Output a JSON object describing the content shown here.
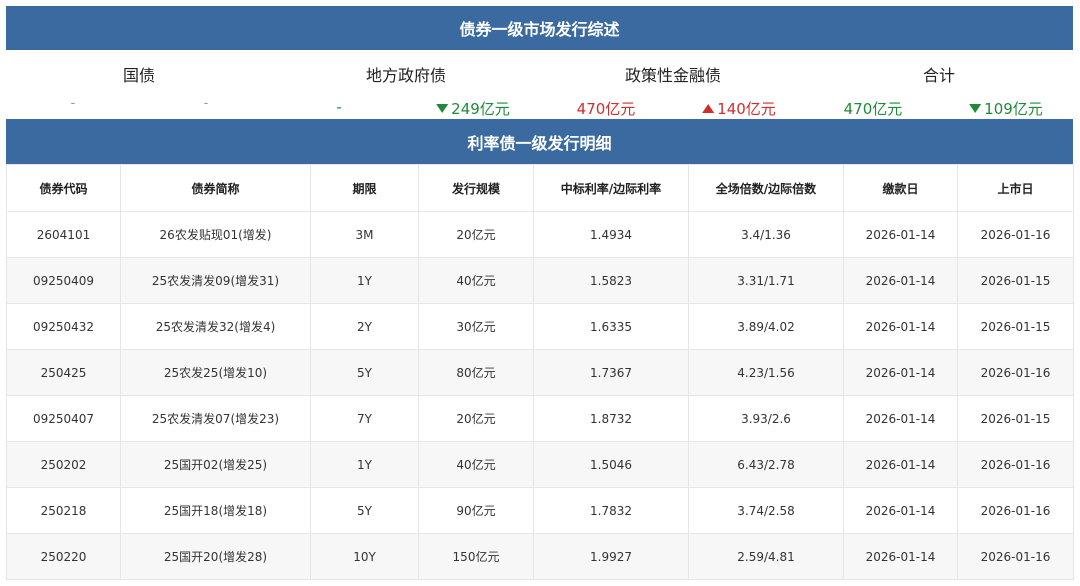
{
  "header": {
    "title": "债券一级市场发行综述"
  },
  "summary": {
    "categories": [
      "国债",
      "地方政府债",
      "政策性金融债",
      "合计"
    ],
    "values": [
      {
        "text": "-",
        "color": "#999999"
      },
      {
        "text": "-",
        "color": "#999999"
      },
      {
        "text": "-",
        "color": "#1f8a3a"
      },
      {
        "text": "249亿元",
        "color": "#1f8a3a",
        "arrow": "down"
      },
      {
        "text": "470亿元",
        "color": "#d12d2d"
      },
      {
        "text": "140亿元",
        "color": "#d12d2d",
        "arrow": "up"
      },
      {
        "text": "470亿元",
        "color": "#1f8a3a"
      },
      {
        "text": "109亿元",
        "color": "#1f8a3a",
        "arrow": "down"
      }
    ]
  },
  "detail": {
    "title": "利率债一级发行明细",
    "columns": [
      "债券代码",
      "债券简称",
      "期限",
      "发行规模",
      "中标利率/边际利率",
      "全场倍数/边际倍数",
      "缴款日",
      "上市日"
    ],
    "rows": [
      [
        "2604101",
        "26农发贴现01(增发)",
        "3M",
        "20亿元",
        "1.4934",
        "3.4/1.36",
        "2026-01-14",
        "2026-01-16"
      ],
      [
        "09250409",
        "25农发清发09(增发31)",
        "1Y",
        "40亿元",
        "1.5823",
        "3.31/1.71",
        "2026-01-14",
        "2026-01-15"
      ],
      [
        "09250432",
        "25农发清发32(增发4)",
        "2Y",
        "30亿元",
        "1.6335",
        "3.89/4.02",
        "2026-01-14",
        "2026-01-15"
      ],
      [
        "250425",
        "25农发25(增发10)",
        "5Y",
        "80亿元",
        "1.7367",
        "4.23/1.56",
        "2026-01-14",
        "2026-01-16"
      ],
      [
        "09250407",
        "25农发清发07(增发23)",
        "7Y",
        "20亿元",
        "1.8732",
        "3.93/2.6",
        "2026-01-14",
        "2026-01-15"
      ],
      [
        "250202",
        "25国开02(增发25)",
        "1Y",
        "40亿元",
        "1.5046",
        "6.43/2.78",
        "2026-01-14",
        "2026-01-16"
      ],
      [
        "250218",
        "25国开18(增发18)",
        "5Y",
        "90亿元",
        "1.7832",
        "3.74/2.58",
        "2026-01-14",
        "2026-01-16"
      ],
      [
        "250220",
        "25国开20(增发28)",
        "10Y",
        "150亿元",
        "1.9927",
        "2.59/4.81",
        "2026-01-14",
        "2026-01-16"
      ]
    ]
  },
  "colors": {
    "header_bg": "#3a6aa0",
    "up": "#d12d2d",
    "down": "#1f8a3a"
  }
}
